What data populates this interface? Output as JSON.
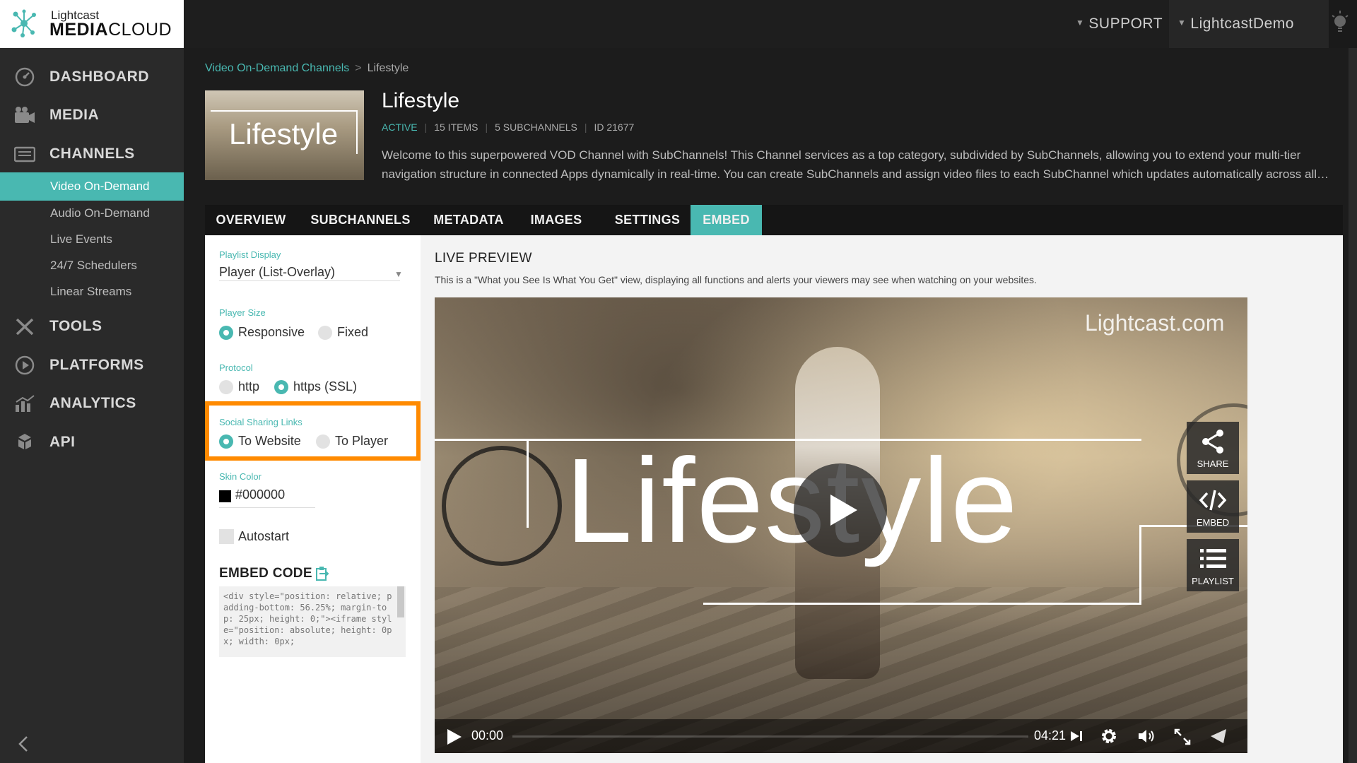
{
  "brand": {
    "top": "Lightcast",
    "main_bold": "MEDIA",
    "main_light": "CLOUD"
  },
  "topbar": {
    "support": "SUPPORT",
    "account": "LightcastDemo"
  },
  "sidebar": {
    "items": [
      {
        "label": "DASHBOARD",
        "icon": "dashboard-icon"
      },
      {
        "label": "MEDIA",
        "icon": "camera-icon"
      },
      {
        "label": "CHANNELS",
        "icon": "channels-icon"
      },
      {
        "label": "TOOLS",
        "icon": "tools-icon"
      },
      {
        "label": "PLATFORMS",
        "icon": "platforms-icon"
      },
      {
        "label": "ANALYTICS",
        "icon": "analytics-icon"
      },
      {
        "label": "API",
        "icon": "api-icon"
      }
    ],
    "channel_subitems": [
      "Video On-Demand",
      "Audio On-Demand",
      "Live Events",
      "24/7 Schedulers",
      "Linear Streams"
    ]
  },
  "breadcrumb": {
    "parent": "Video On-Demand Channels",
    "separator": ">",
    "current": "Lifestyle"
  },
  "channel": {
    "thumb_text": "Lifestyle",
    "title": "Lifestyle",
    "status": "ACTIVE",
    "items": "15 ITEMS",
    "subchannels": "5 SUBCHANNELS",
    "id": "ID 21677",
    "description": "Welcome to this superpowered VOD Channel with SubChannels! This Channel services as a top category, subdivided by SubChannels, allowing you to extend your multi-tier navigation structure in connected Apps dynamically in real-time. You can create SubChannels and assign video files to each SubChannel which updates automatically across all…"
  },
  "tabs": [
    "OVERVIEW",
    "SUBCHANNELS",
    "METADATA",
    "IMAGES",
    "SETTINGS",
    "EMBED"
  ],
  "active_tab": "EMBED",
  "settings": {
    "playlist_display_label": "Playlist Display",
    "playlist_display_value": "Player (List-Overlay)",
    "player_size_label": "Player Size",
    "player_size_options": [
      "Responsive",
      "Fixed"
    ],
    "player_size_selected": "Responsive",
    "protocol_label": "Protocol",
    "protocol_options": [
      "http",
      "https (SSL)"
    ],
    "protocol_selected": "https (SSL)",
    "social_label": "Social Sharing Links",
    "social_options": [
      "To Website",
      "To Player"
    ],
    "social_selected": "To Website",
    "skin_color_label": "Skin Color",
    "skin_color_value": "#000000",
    "autostart_label": "Autostart",
    "embed_code_title": "EMBED CODE",
    "embed_code": "<div style=\"position: relative; padding-bottom: 56.25%; margin-top: 25px; height: 0;\"><iframe style=\"position: absolute; height: 0px; width: 0px;"
  },
  "preview": {
    "title": "LIVE PREVIEW",
    "subtitle": "This is a \"What you See Is What You Get\" view, displaying all functions and alerts your viewers may see when watching on your websites.",
    "watermark": "Lightcast.com",
    "video_title": "Lifestyle",
    "side_buttons": [
      "SHARE",
      "EMBED",
      "PLAYLIST"
    ],
    "current_time": "00:00",
    "duration": "04:21"
  },
  "colors": {
    "accent": "#49b8b1",
    "highlight": "#ff8a00",
    "sidebar": "#2a2a2a",
    "topbar": "#1e1e1e"
  }
}
